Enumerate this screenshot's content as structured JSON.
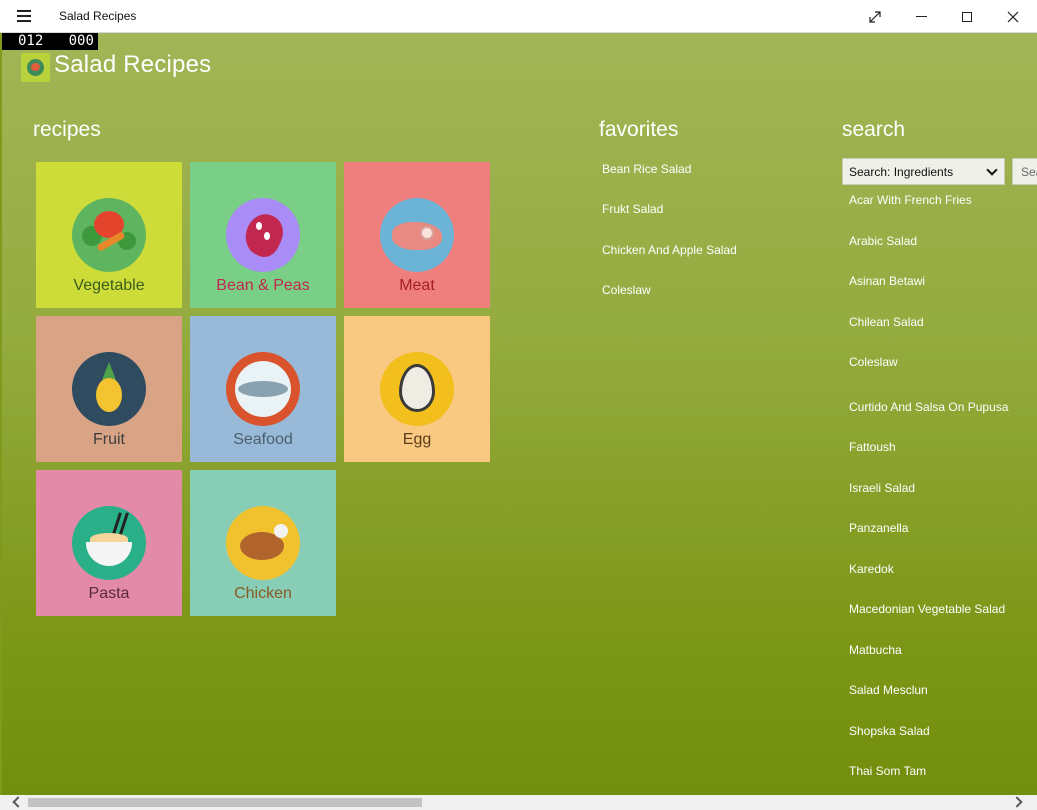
{
  "window": {
    "title": "Salad Recipes",
    "menu_icon": "hamburger-icon",
    "controls": [
      "fullscreen-icon",
      "minimize-icon",
      "maximize-icon",
      "close-icon"
    ]
  },
  "counter": {
    "left": "012",
    "right": "000"
  },
  "header": {
    "app_title": "Salad Recipes",
    "logo_icon": "salad-logo-icon"
  },
  "recipes": {
    "heading": "recipes",
    "tiles": [
      {
        "label": "Vegetable",
        "bg": "#cddc39",
        "circle": "#5fb55f",
        "label_color": "#3b5e1f",
        "icon": "vegetables-icon"
      },
      {
        "label": "Bean & Peas",
        "bg": "#79cf86",
        "circle": "#a98cf5",
        "label_color": "#c2274f",
        "icon": "bean-icon"
      },
      {
        "label": "Meat",
        "bg": "#ef7f7d",
        "circle": "#6bb4d8",
        "label_color": "#a51f28",
        "icon": "meat-icon"
      },
      {
        "label": "Fruit",
        "bg": "#d9a485",
        "circle": "#2f4b60",
        "label_color": "#3d3d3d",
        "icon": "pineapple-icon"
      },
      {
        "label": "Seafood",
        "bg": "#98bad8",
        "circle": "#d9532c",
        "label_color": "#4b5e6e",
        "icon": "fish-icon"
      },
      {
        "label": "Egg",
        "bg": "#f9c982",
        "circle": "#f2bf1c",
        "label_color": "#5b3d1a",
        "icon": "egg-icon"
      },
      {
        "label": "Pasta",
        "bg": "#e38aa9",
        "circle": "#2ab089",
        "label_color": "#5b2a3f",
        "icon": "noodle-bowl-icon"
      },
      {
        "label": "Chicken",
        "bg": "#88cdb6",
        "circle": "#f1c22e",
        "label_color": "#8a5a22",
        "icon": "roast-chicken-icon"
      }
    ]
  },
  "favorites": {
    "heading": "favorites",
    "items": [
      "Bean Rice Salad",
      "Frukt Salad",
      "Chicken And Apple Salad",
      "Coleslaw"
    ]
  },
  "search": {
    "heading": "search",
    "select_value": "Search: Ingredients",
    "button_label": "Sea",
    "results": [
      "Acar With French Fries",
      "Arabic Salad",
      "Asinan Betawi",
      "Chilean Salad",
      "Coleslaw",
      "Curtido And Salsa On Pupusa",
      "Fattoush",
      "Israeli Salad",
      "Panzanella",
      "Karedok",
      "Macedonian Vegetable Salad",
      "Matbucha",
      "Salad Mesclun",
      "Shopska Salad",
      "Thai Som Tam"
    ]
  },
  "colors": {
    "titlebar": "#ffffff",
    "background_top": "#a2b557",
    "background_bottom": "#738e0d"
  }
}
